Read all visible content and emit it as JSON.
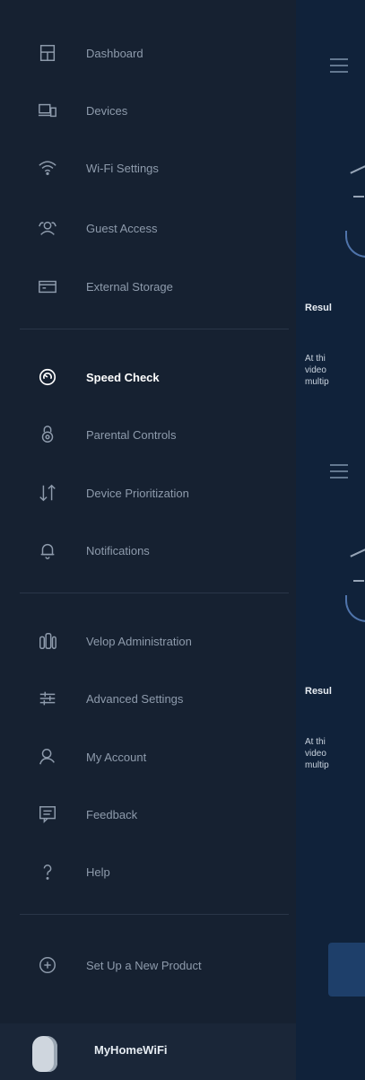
{
  "drawer": {
    "items": [
      {
        "label": "Dashboard",
        "icon": "dashboard-icon"
      },
      {
        "label": "Devices",
        "icon": "devices-icon"
      },
      {
        "label": "Wi-Fi Settings",
        "icon": "wifi-icon"
      },
      {
        "label": "Guest Access",
        "icon": "guest-access-icon"
      },
      {
        "label": "External Storage",
        "icon": "external-storage-icon"
      },
      {
        "label": "Speed Check",
        "icon": "speed-check-icon",
        "active": true
      },
      {
        "label": "Parental Controls",
        "icon": "parental-controls-icon"
      },
      {
        "label": "Device Prioritization",
        "icon": "device-prioritization-icon"
      },
      {
        "label": "Notifications",
        "icon": "notifications-icon"
      },
      {
        "label": "Velop Administration",
        "icon": "velop-admin-icon"
      },
      {
        "label": "Advanced Settings",
        "icon": "advanced-settings-icon"
      },
      {
        "label": "My Account",
        "icon": "account-icon"
      },
      {
        "label": "Feedback",
        "icon": "feedback-icon"
      },
      {
        "label": "Help",
        "icon": "help-icon"
      },
      {
        "label": "Set Up a New Product",
        "icon": "add-product-icon"
      }
    ],
    "footer": {
      "network_name": "MyHomeWiFi"
    }
  },
  "background": {
    "result_label_1": "Resul",
    "result_label_2": "Resul",
    "para_1": [
      "At thi",
      "video",
      "multip"
    ],
    "para_2": [
      "At thi",
      "video",
      "multip"
    ]
  },
  "colors": {
    "drawer_bg": "#162131",
    "active_text": "#ffffff",
    "inactive_text": "#8e9bac",
    "app_bg": "#10223a"
  }
}
